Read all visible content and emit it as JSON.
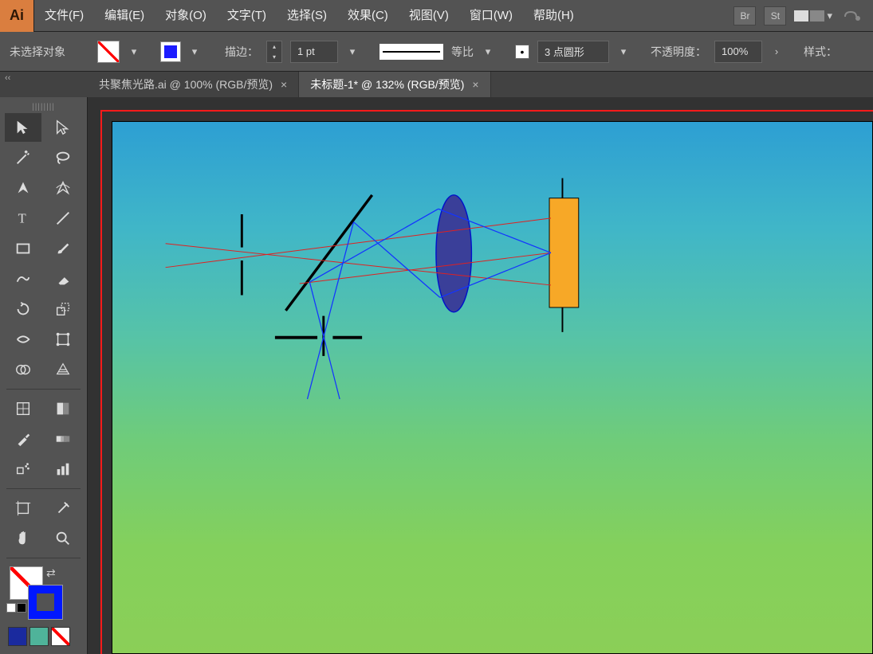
{
  "app": {
    "logo": "Ai"
  },
  "menu": {
    "file": "文件(F)",
    "edit": "编辑(E)",
    "object": "对象(O)",
    "type": "文字(T)",
    "select": "选择(S)",
    "effect": "效果(C)",
    "view": "视图(V)",
    "window": "窗口(W)",
    "help": "帮助(H)",
    "br": "Br",
    "st": "St"
  },
  "control": {
    "selection_status": "未选择对象",
    "stroke_label": "描边：",
    "stroke_weight": "1 pt",
    "profile_label": "等比",
    "brush_label": "3 点圆形",
    "opacity_label": "不透明度：",
    "opacity_value": "100%",
    "style_label": "样式："
  },
  "tabs": {
    "collapse": "‹‹",
    "tab1": "共聚焦光路.ai @ 100% (RGB/预览)",
    "tab2": "未标题-1* @ 132% (RGB/预览)"
  },
  "swatches": {
    "c1": "#1a2a9e",
    "c2": "#4fb39a",
    "c3_none": true
  }
}
